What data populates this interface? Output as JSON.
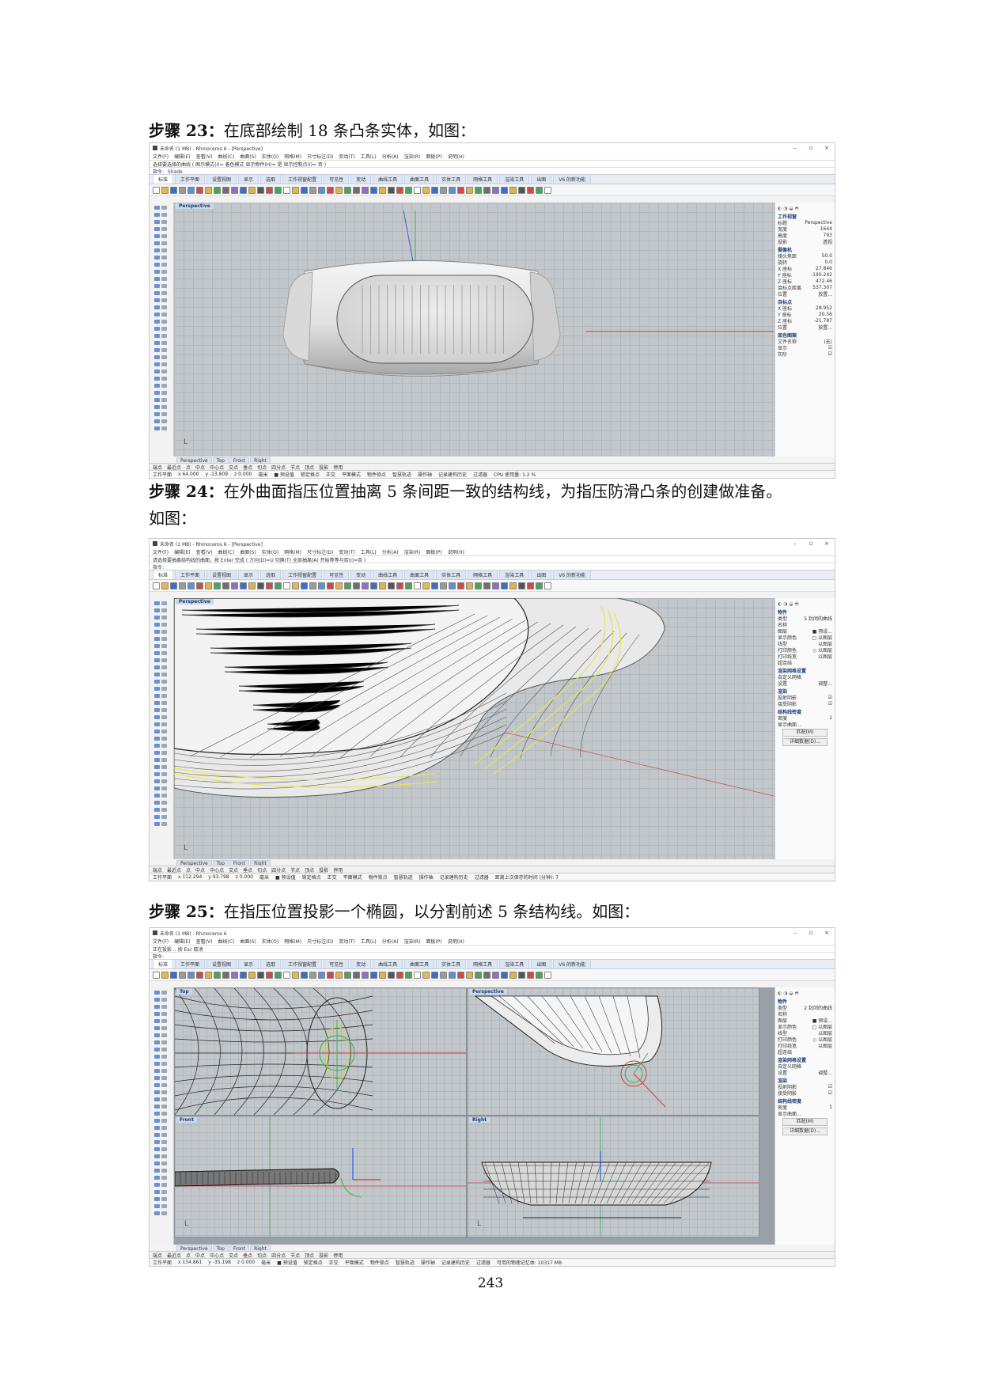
{
  "steps": [
    {
      "label": "步骤 23：",
      "text": "在底部绘制 18 条凸条实体，如图："
    },
    {
      "label": "步骤 24：",
      "text": "在外曲面指压位置抽离 5 条间距一致的结构线，为指压防滑凸条的创建做准备。",
      "text2": "如图："
    },
    {
      "label": "步骤 25：",
      "text": "在指压位置投影一个椭圆，以分割前述 5 条结构线。如图："
    }
  ],
  "page_number": "243",
  "rhino": {
    "title1": "未命名 (1 MB) - Rhinoceros 6 - [Perspective]",
    "title2": "未命名 (1 MB) - Rhinoceros 6 - [Perspective]",
    "title3": "未命名 (1 MB) - Rhinoceros 6",
    "window_controls": [
      "–",
      "▫",
      "×"
    ],
    "menu": [
      "文件(F)",
      "编辑(E)",
      "查看(V)",
      "曲线(C)",
      "曲面(S)",
      "实体(O)",
      "网格(M)",
      "尺寸标注(D)",
      "变动(T)",
      "工具(L)",
      "分析(A)",
      "渲染(R)",
      "面板(P)",
      "说明(H)"
    ],
    "cmd1": "选择要选择的曲线 ( 图示模式(I)= 着色模式 显示物件(H)= 是 显示控制点(I)= 否 )",
    "cmdline1": "指令: _Shade",
    "cmd2": "请选择要抽离结构线的曲面，按 Enter 完成 ( 方向(D)=U 切换(T) 全部抽离(A) 开始等等与否(I)=否 )",
    "cmdline2": "指令:",
    "cmd3": "正在投影... 按 Esc 取消",
    "cmdline3": "指令:",
    "tabs": [
      "标准",
      "工作平面",
      "设置视图",
      "显示",
      "选取",
      "工作视窗配置",
      "可见性",
      "变动",
      "曲线工具",
      "曲面工具",
      "实体工具",
      "网格工具",
      "渲染工具",
      "出图",
      "V6 的新功能"
    ],
    "viewport_tabs": [
      "Perspective",
      "Top",
      "Front",
      "Right"
    ],
    "osnap": [
      "端点",
      "最近点",
      "点",
      "中点",
      "中心点",
      "交点",
      "垂点",
      "切点",
      "四分点",
      "节点",
      "顶点",
      "投影",
      "停用"
    ],
    "status1": [
      "工作平面",
      "x 64.000",
      "y -13.809",
      "z 0.000",
      "毫米",
      "■ 预设值",
      "锁定格点",
      "正交",
      "平面模式",
      "物件锁点",
      "智慧轨迹",
      "操作轴",
      "记录建构历史",
      "过滤器",
      "CPU 使用量: 1.2 %"
    ],
    "status2": [
      "工作平面",
      "x 112.294",
      "y 93.798",
      "z 0.000",
      "毫米",
      "■ 预设值",
      "锁定格点",
      "正交",
      "平面模式",
      "物件锁点",
      "智慧轨迹",
      "操作轴",
      "记录建构历史",
      "过滤器",
      "距离上次保存的时间 (分钟): 7"
    ],
    "status3": [
      "工作平面",
      "x 134.861",
      "y -35.198",
      "z 0.000",
      "毫米",
      "■ 预设值",
      "锁定格点",
      "正交",
      "平面模式",
      "物件锁点",
      "智慧轨迹",
      "操作轴",
      "记录建构历史",
      "过滤器",
      "可用的物理记忆体: 10317 MB"
    ],
    "viewport_label": "Perspective",
    "quad_labels": [
      "Top",
      "Perspective",
      "Front",
      "Right"
    ],
    "panel1": {
      "section": "工作视窗",
      "rows": [
        [
          "标题",
          "Perspective"
        ],
        [
          "宽度",
          "1644"
        ],
        [
          "高度",
          "793"
        ],
        [
          "投影",
          "透视"
        ]
      ],
      "camera": "摄像机",
      "camrows": [
        [
          "镜头焦距",
          "50.0"
        ],
        [
          "旋转",
          "0.0"
        ],
        [
          "X 座标",
          "27.846"
        ],
        [
          "Y 座标",
          "-190.242"
        ],
        [
          "Z 座标",
          "472.46"
        ],
        [
          "目标点距离",
          "537.307"
        ],
        [
          "位置",
          "放置..."
        ]
      ],
      "target": "目标点",
      "tgtrows": [
        [
          "X 座标",
          "28.952"
        ],
        [
          "Y 座标",
          "20.56"
        ],
        [
          "Z 座标",
          "-21.787"
        ],
        [
          "位置",
          "放置..."
        ]
      ],
      "wall": "底色图案",
      "wallrows": [
        [
          "文件名称",
          "(无)"
        ],
        [
          "显示",
          "☑"
        ],
        [
          "灰阶",
          "☑"
        ]
      ]
    },
    "panel2": {
      "section": "物件",
      "rows": [
        [
          "类型",
          "5 封闭的曲线"
        ],
        [
          "名称",
          ""
        ],
        [
          "图层",
          "■ 预设..."
        ],
        [
          "显示颜色",
          "□ 以图层"
        ],
        [
          "线型",
          "以图层"
        ],
        [
          "打印颜色",
          "◇ 以图层"
        ],
        [
          "打印线宽",
          "以图层"
        ],
        [
          "超连结",
          ""
        ]
      ],
      "render": "渲染网格设置",
      "rrows": [
        [
          "自定义网格",
          ""
        ],
        [
          "设置",
          "调整..."
        ]
      ],
      "shade": "渲染",
      "srows": [
        [
          "投射阴影",
          "☑"
        ],
        [
          "接受阴影",
          "☑"
        ]
      ],
      "iso": "结构线密度",
      "irows": [
        [
          "密度",
          "1"
        ],
        [
          "显示曲面...",
          ""
        ]
      ],
      "btn1": "匹配(M)",
      "btn2": "详细数据(D)..."
    },
    "panel3": {
      "section": "物件",
      "rows": [
        [
          "类型",
          "2 封闭的曲线"
        ],
        [
          "名称",
          ""
        ],
        [
          "图层",
          "■ 预设..."
        ],
        [
          "显示颜色",
          "□ 以图层"
        ],
        [
          "线型",
          "以图层"
        ],
        [
          "打印颜色",
          "◇ 以图层"
        ],
        [
          "打印线宽",
          "以图层"
        ],
        [
          "超连结",
          ""
        ]
      ],
      "render": "渲染网格设置",
      "rrows": [
        [
          "自定义网格",
          ""
        ],
        [
          "设置",
          "调整..."
        ]
      ],
      "shade": "渲染",
      "srows": [
        [
          "投射阴影",
          "☑"
        ],
        [
          "接受阴影",
          "☑"
        ]
      ],
      "iso": "结构线密度",
      "irows": [
        [
          "密度",
          "1"
        ],
        [
          "显示曲面...",
          ""
        ]
      ],
      "btn1": "匹配(M)",
      "btn2": "详细数据(D)..."
    }
  }
}
